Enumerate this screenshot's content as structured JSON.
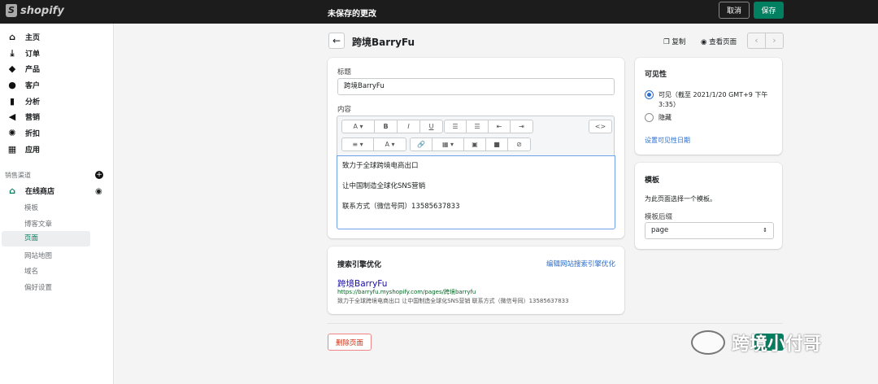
{
  "topbar": {
    "logo": "shopify",
    "title": "未保存的更改",
    "cancel": "取消",
    "save": "保存"
  },
  "sidebar": {
    "items": [
      {
        "label": "主页",
        "icon": "home-icon"
      },
      {
        "label": "订单",
        "icon": "orders-icon"
      },
      {
        "label": "产品",
        "icon": "tag-icon"
      },
      {
        "label": "客户",
        "icon": "person-icon"
      },
      {
        "label": "分析",
        "icon": "bar-chart-icon"
      },
      {
        "label": "营销",
        "icon": "megaphone-icon"
      },
      {
        "label": "折扣",
        "icon": "discount-icon"
      },
      {
        "label": "应用",
        "icon": "apps-icon"
      }
    ],
    "section": "销售渠道",
    "channel": "在线商店",
    "sub": [
      "模板",
      "博客文章",
      "页面",
      "网站地图",
      "域名",
      "偏好设置"
    ]
  },
  "header": {
    "title": "跨境BarryFu",
    "duplicate": "复制",
    "view": "查看页面"
  },
  "main": {
    "title_label": "标题",
    "title_value": "跨境BarryFu",
    "content_label": "内容",
    "content": [
      "致力于全球跨境电商出口",
      "让中国制造全球化SNS营销",
      "联系方式（微信号同）13585637833"
    ]
  },
  "visibility": {
    "title": "可见性",
    "visible": "可见（截至 2021/1/20 GMT+9 下午 3:35）",
    "hidden": "隐藏",
    "set_date": "设置可见性日期"
  },
  "template": {
    "title": "模板",
    "desc": "为此页面选择一个模板。",
    "suffix_label": "模板后缀",
    "suffix_value": "page"
  },
  "seo": {
    "title": "搜索引擎优化",
    "edit": "编辑网站搜索引擎优化",
    "preview_title": "跨境BarryFu",
    "url": "https://barryfu.myshopify.com/pages/跨境barryfu",
    "desc": "致力于全球跨境电商出口 让中国制造全球化SNS营销 联系方式（微信号同）13585637833"
  },
  "delete": "删除页面",
  "watermark": "跨境小付哥"
}
